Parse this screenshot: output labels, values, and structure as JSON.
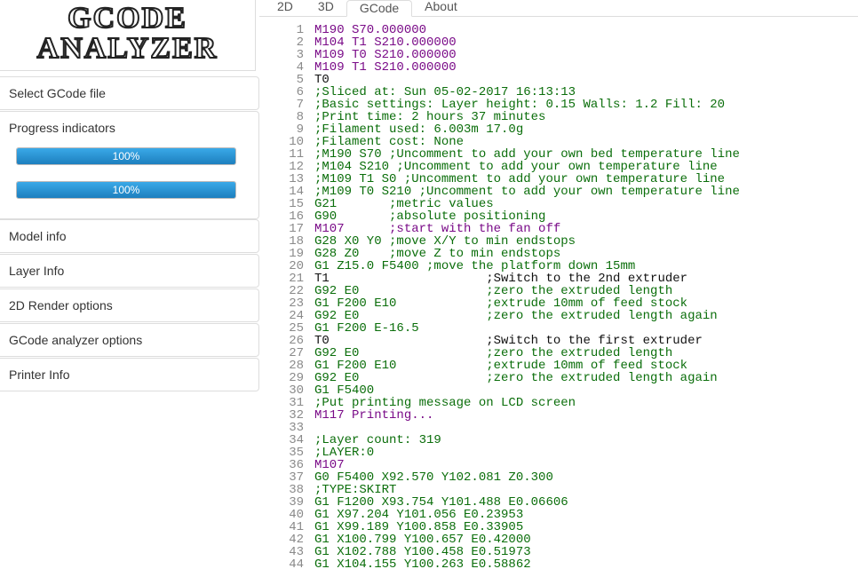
{
  "logo": {
    "line1": "GCODE",
    "line2": "ANALYZER"
  },
  "sidebar": {
    "select_file": "Select GCode file",
    "progress_title": "Progress indicators",
    "progress1": "100%",
    "progress2": "100%",
    "model_info": "Model info",
    "layer_info": "Layer Info",
    "render2d": "2D Render options",
    "analyzer_opts": "GCode analyzer options",
    "printer_info": "Printer Info"
  },
  "tabs": {
    "t2d": "2D",
    "t3d": "3D",
    "gcode": "GCode",
    "about": "About"
  },
  "code": [
    {
      "n": 1,
      "cls": "mcode",
      "t": "M190 S70.000000"
    },
    {
      "n": 2,
      "cls": "mcode",
      "t": "M104 T1 S210.000000"
    },
    {
      "n": 3,
      "cls": "mcode",
      "t": "M109 T0 S210.000000"
    },
    {
      "n": 4,
      "cls": "mcode",
      "t": "M109 T1 S210.000000"
    },
    {
      "n": 5,
      "cls": "tcode",
      "t": "T0"
    },
    {
      "n": 6,
      "cls": "cmt",
      "t": ";Sliced at: Sun 05-02-2017 16:13:13"
    },
    {
      "n": 7,
      "cls": "cmt",
      "t": ";Basic settings: Layer height: 0.15 Walls: 1.2 Fill: 20"
    },
    {
      "n": 8,
      "cls": "cmt",
      "t": ";Print time: 2 hours 37 minutes"
    },
    {
      "n": 9,
      "cls": "cmt",
      "t": ";Filament used: 6.003m 17.0g"
    },
    {
      "n": 10,
      "cls": "cmt",
      "t": ";Filament cost: None"
    },
    {
      "n": 11,
      "cls": "cmt",
      "t": ";M190 S70 ;Uncomment to add your own bed temperature line"
    },
    {
      "n": 12,
      "cls": "cmt",
      "t": ";M104 S210 ;Uncomment to add your own temperature line"
    },
    {
      "n": 13,
      "cls": "cmt",
      "t": ";M109 T1 S0 ;Uncomment to add your own temperature line"
    },
    {
      "n": 14,
      "cls": "cmt",
      "t": ";M109 T0 S210 ;Uncomment to add your own temperature line"
    },
    {
      "n": 15,
      "cls": "gcode",
      "t": "G21       ;metric values"
    },
    {
      "n": 16,
      "cls": "gcode",
      "t": "G90       ;absolute positioning"
    },
    {
      "n": 17,
      "cls": "mcode",
      "t": "M107      ;start with the fan off"
    },
    {
      "n": 18,
      "cls": "gcode",
      "t": "G28 X0 Y0 ;move X/Y to min endstops"
    },
    {
      "n": 19,
      "cls": "gcode",
      "t": "G28 Z0    ;move Z to min endstops"
    },
    {
      "n": 20,
      "cls": "gcode",
      "t": "G1 Z15.0 F5400 ;move the platform down 15mm"
    },
    {
      "n": 21,
      "cls": "tcode",
      "t": "T1                     ;Switch to the 2nd extruder"
    },
    {
      "n": 22,
      "cls": "gcode",
      "t": "G92 E0                 ;zero the extruded length"
    },
    {
      "n": 23,
      "cls": "gcode",
      "t": "G1 F200 E10            ;extrude 10mm of feed stock"
    },
    {
      "n": 24,
      "cls": "gcode",
      "t": "G92 E0                 ;zero the extruded length again"
    },
    {
      "n": 25,
      "cls": "gcode",
      "t": "G1 F200 E-16.5"
    },
    {
      "n": 26,
      "cls": "tcode",
      "t": "T0                     ;Switch to the first extruder"
    },
    {
      "n": 27,
      "cls": "gcode",
      "t": "G92 E0                 ;zero the extruded length"
    },
    {
      "n": 28,
      "cls": "gcode",
      "t": "G1 F200 E10            ;extrude 10mm of feed stock"
    },
    {
      "n": 29,
      "cls": "gcode",
      "t": "G92 E0                 ;zero the extruded length again"
    },
    {
      "n": 30,
      "cls": "gcode",
      "t": "G1 F5400"
    },
    {
      "n": 31,
      "cls": "cmt",
      "t": ";Put printing message on LCD screen"
    },
    {
      "n": 32,
      "cls": "mcode",
      "t": "M117 Printing..."
    },
    {
      "n": 33,
      "cls": "plain",
      "t": ""
    },
    {
      "n": 34,
      "cls": "cmt",
      "t": ";Layer count: 319"
    },
    {
      "n": 35,
      "cls": "cmt",
      "t": ";LAYER:0"
    },
    {
      "n": 36,
      "cls": "mcode",
      "t": "M107"
    },
    {
      "n": 37,
      "cls": "move",
      "t": "G0 F5400 X92.570 Y102.081 Z0.300"
    },
    {
      "n": 38,
      "cls": "cmt",
      "t": ";TYPE:SKIRT"
    },
    {
      "n": 39,
      "cls": "move",
      "t": "G1 F1200 X93.754 Y101.488 E0.06606"
    },
    {
      "n": 40,
      "cls": "move",
      "t": "G1 X97.204 Y101.056 E0.23953"
    },
    {
      "n": 41,
      "cls": "move",
      "t": "G1 X99.189 Y100.858 E0.33905"
    },
    {
      "n": 42,
      "cls": "move",
      "t": "G1 X100.799 Y100.657 E0.42000"
    },
    {
      "n": 43,
      "cls": "move",
      "t": "G1 X102.788 Y100.458 E0.51973"
    },
    {
      "n": 44,
      "cls": "move",
      "t": "G1 X104.155 Y100.263 E0.58862"
    }
  ]
}
